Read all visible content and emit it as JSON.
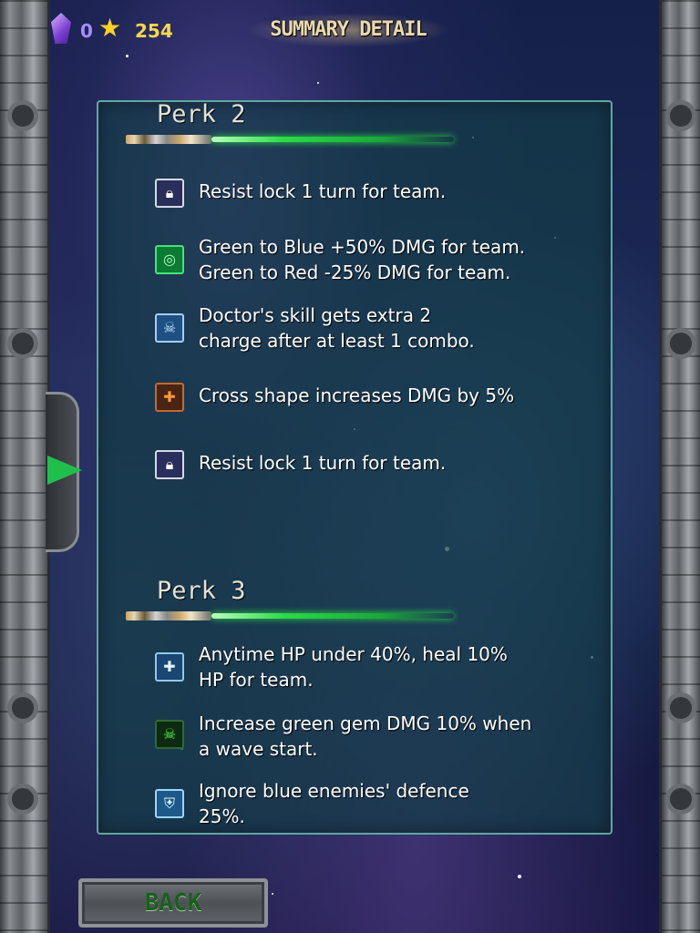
{
  "header": {
    "title": "SUMMARY DETAIL",
    "gem_icon": "purple-gem-icon",
    "gem_count": "0",
    "star_icon": "gold-star-icon",
    "star_count": "254"
  },
  "perks": [
    {
      "title": "Perk 2",
      "items": [
        {
          "icon": "lock-icon",
          "text": "Resist lock 1 turn for team."
        },
        {
          "icon": "green-swirl-icon",
          "text": "Green to Blue +50% DMG for team.\nGreen to Red -25% DMG for team."
        },
        {
          "icon": "doctor-skull-icon",
          "text": "Doctor's skill gets extra 2\ncharge after at least 1 combo."
        },
        {
          "icon": "cross-shape-icon",
          "text": "Cross shape increases DMG by 5%"
        },
        {
          "icon": "lock-icon",
          "text": "Resist lock 1 turn for team."
        }
      ]
    },
    {
      "title": "Perk 3",
      "items": [
        {
          "icon": "heal-cross-icon",
          "text": "Anytime HP under 40%, heal 10%\nHP for team."
        },
        {
          "icon": "green-skull-icon",
          "text": "Increase green gem DMG 10% when\na wave start."
        },
        {
          "icon": "blue-shield-icon",
          "text": "Ignore blue enemies' defence\n25%."
        }
      ]
    }
  ],
  "footer": {
    "back_label": "BACK"
  },
  "colors": {
    "panel_border": "#5fa7a3",
    "saber_green": "#2cd94a",
    "star_count": "#ffd64a",
    "gem_count": "#a98cff"
  }
}
